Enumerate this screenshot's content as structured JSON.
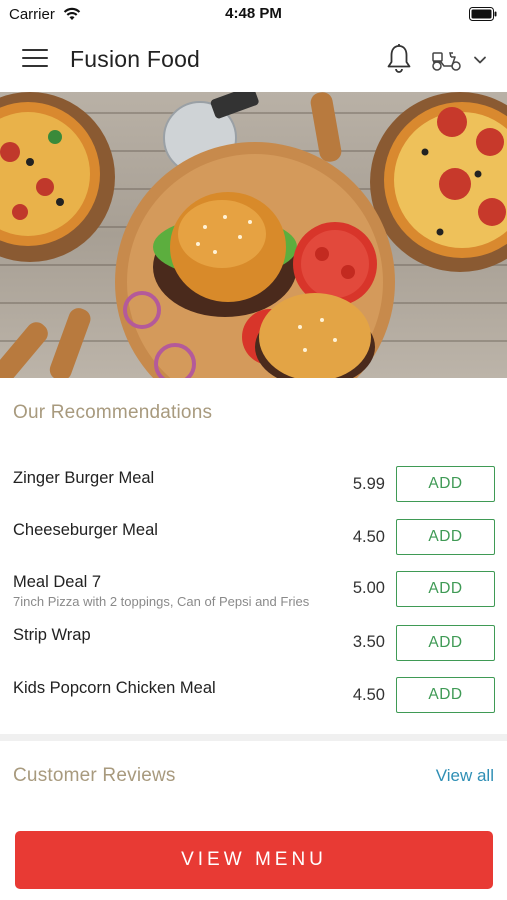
{
  "status_bar": {
    "carrier": "Carrier",
    "time": "4:48 PM"
  },
  "header": {
    "title": "Fusion Food",
    "icons": [
      "menu-icon",
      "bell-icon",
      "delivery-scooter-icon",
      "chevron-down-icon"
    ]
  },
  "hero": {
    "image": "burgers-and-pizzas-photo"
  },
  "recommendations": {
    "title": "Our Recommendations",
    "items": [
      {
        "name": "Zinger Burger Meal",
        "description": "",
        "price": "5.99",
        "button": "ADD"
      },
      {
        "name": "Cheeseburger Meal",
        "description": "",
        "price": "4.50",
        "button": "ADD"
      },
      {
        "name": "Meal Deal 7",
        "description": "7inch Pizza with 2 toppings, Can of Pepsi and Fries",
        "price": "5.00",
        "button": "ADD"
      },
      {
        "name": "Strip Wrap",
        "description": "",
        "price": "3.50",
        "button": "ADD"
      },
      {
        "name": "Kids Popcorn Chicken Meal",
        "description": "",
        "price": "4.50",
        "button": "ADD"
      }
    ]
  },
  "reviews": {
    "title": "Customer Reviews",
    "view_all": "View all"
  },
  "footer": {
    "view_menu": "VIEW MENU"
  },
  "colors": {
    "accent_red": "#e83a34",
    "add_green": "#3f9a55",
    "section_title": "#a89a7e",
    "link_blue": "#2f8fb5"
  }
}
